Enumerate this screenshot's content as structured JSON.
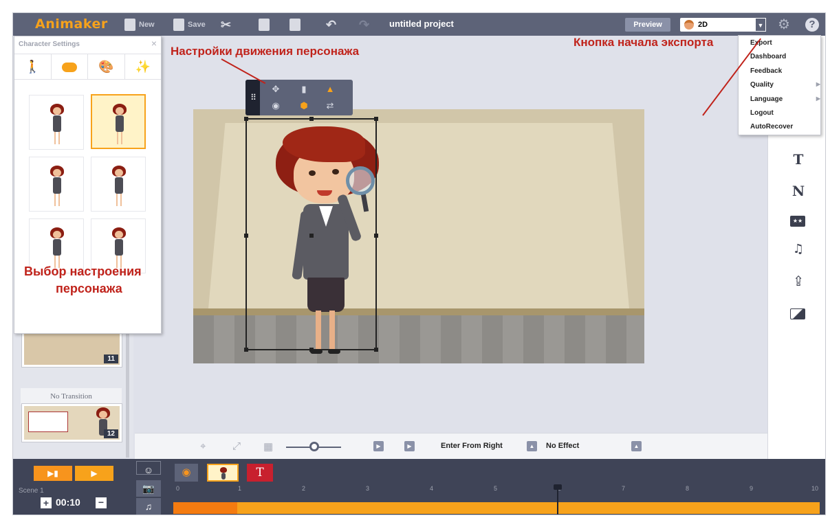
{
  "topbar": {
    "logo": "Animaker",
    "new_label": "New",
    "save_label": "Save",
    "project_title": "untitled project",
    "preview_label": "Preview",
    "mode_value": "2D"
  },
  "char_settings": {
    "title": "Character Settings",
    "close": "×",
    "tabs": [
      "character-tab",
      "face-tab",
      "color-tab",
      "effects-tab"
    ]
  },
  "scenes": [
    {
      "number": "11"
    },
    {
      "number": "12"
    }
  ],
  "transition_label": "No Transition",
  "stage_toolbar": {
    "enter_effect": "Enter From Right",
    "exit_effect": "No Effect"
  },
  "settings_menu": {
    "items": [
      "Export",
      "Dashboard",
      "Feedback",
      "Quality",
      "Language",
      "Logout",
      "AutoRecover"
    ]
  },
  "right_tools": {
    "text_tool": "T",
    "name_tool": "N",
    "rating_tool": "★★",
    "music_tool": "♫"
  },
  "timeline": {
    "scene_label": "Scene 1",
    "duration": "00:10",
    "plus": "+",
    "minus": "−",
    "text_layer": "T",
    "ruler_labels": [
      "0",
      "1",
      "2",
      "3",
      "4",
      "5",
      "6",
      "7",
      "8",
      "9",
      "10"
    ]
  },
  "annotations": {
    "motion_settings": "Настройки движения персонажа",
    "export_button": "Кнопка начала экспорта",
    "mood_line1": "Выбор настроения",
    "mood_line2": "персонажа"
  },
  "colors": {
    "accent_orange": "#f7a21b",
    "toolbar_bg": "#5d6378",
    "annotation_red": "#c0231b"
  },
  "icons": {
    "cut": "scissors-icon",
    "copy": "copy-icon",
    "paste": "paste-icon",
    "undo": "undo-icon",
    "redo": "redo-icon",
    "settings": "gear-icon",
    "help": "question-icon"
  }
}
